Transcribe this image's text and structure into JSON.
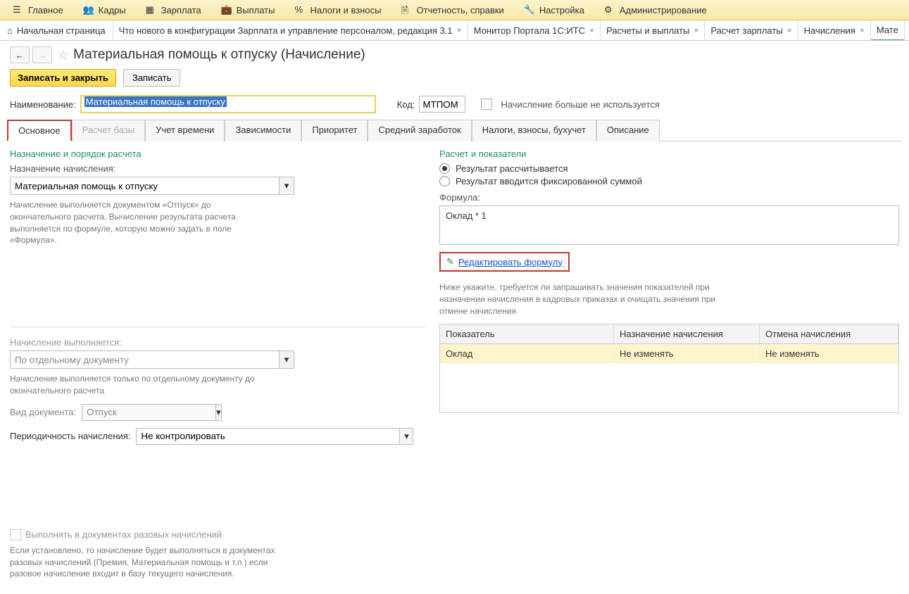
{
  "topnav": {
    "items": [
      {
        "label": "Главное"
      },
      {
        "label": "Кадры"
      },
      {
        "label": "Зарплата"
      },
      {
        "label": "Выплаты"
      },
      {
        "label": "Налоги и взносы"
      },
      {
        "label": "Отчетность, справки"
      },
      {
        "label": "Настройка"
      },
      {
        "label": "Администрирование"
      }
    ]
  },
  "tabs": {
    "home": "Начальная страница",
    "items": [
      "Что нового в конфигурации Зарплата и управление персоналом, редакция 3.1",
      "Монитор Портала 1С:ИТС",
      "Расчеты и выплаты",
      "Расчет зарплаты",
      "Начисления",
      "Мате"
    ]
  },
  "page": {
    "title": "Материальная помощь к отпуску (Начисление)"
  },
  "toolbar": {
    "save_close": "Записать и закрыть",
    "save": "Записать"
  },
  "form": {
    "name_label": "Наименование:",
    "name_value": "Материальная помощь к отпуску",
    "code_label": "Код:",
    "code_value": "МТПОМ",
    "unused_label": "Начисление больше не используется"
  },
  "subtabs": [
    "Основное",
    "Расчет базы",
    "Учет времени",
    "Зависимости",
    "Приоритет",
    "Средний заработок",
    "Налоги, взносы, бухучет",
    "Описание"
  ],
  "left": {
    "section": "Назначение и порядок расчета",
    "purpose_label": "Назначение начисления:",
    "purpose_value": "Материальная помощь к отпуску",
    "purpose_help": "Начисление выполняется документом «Отпуск» до окончательного расчета. Вычисление результата расчета выполняется по формуле, которую можно задать в поле «Формула».",
    "exec_label": "Начисление выполняется:",
    "exec_value": "По отдельному документу",
    "exec_help": "Начисление выполняется только по отдельному документу до окончательного расчета",
    "doc_type_label": "Вид документа:",
    "doc_type_value": "Отпуск",
    "period_label": "Периодичность начисления:",
    "period_value": "Не контролировать",
    "onetime_label": "Выполнять в документах разовых начислений",
    "onetime_help": "Если установлено, то начисление будет выполняться в документах разовых начислений (Премия, Материальная помощь и т.п.) если разовое начисление входит в базу текущего начисления."
  },
  "right": {
    "section": "Расчет и показатели",
    "radio1": "Результат рассчитывается",
    "radio2": "Результат вводится фиксированной суммой",
    "formula_label": "Формула:",
    "formula_value": "Оклад * 1",
    "edit_link": "Редактировать формулу",
    "table_help": "Ниже укажите, требуется ли запрашивать значения показателей при назначении начисления в кадровых приказах и очищать значения при отмене начисления",
    "th1": "Показатель",
    "th2": "Назначение начисления",
    "th3": "Отмена начисления",
    "row": {
      "c1": "Оклад",
      "c2": "Не изменять",
      "c3": "Не изменять"
    }
  }
}
